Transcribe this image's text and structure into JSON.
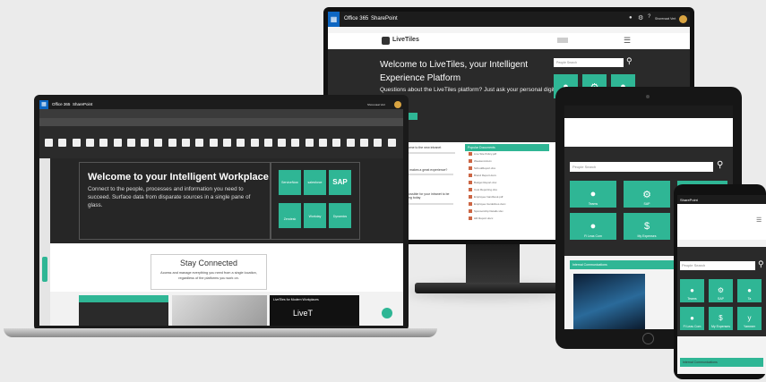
{
  "monitor": {
    "suite_title": "Office 365",
    "app_title": "SharePoint",
    "user_name": "Shorenaat Vert",
    "search_placeholder": "People Search",
    "brand": "LiveTiles",
    "hero_title": "Welcome to LiveTiles, your Intelligent Experience Platform",
    "hero_subtitle": "Questions about the LiveTiles platform? Just ask your personal digital",
    "news_title": "Welcome to the new intranet",
    "news_heading": "What makes a great experience?",
    "news_heading_2": "Is it possible for your intranet to be exciting today",
    "docs_title": "Popular Documents",
    "documents": [
      "Live Site Policy.pdf",
      "Weekend.docx",
      "SchoolReport.xlsx",
      "Brand Report.docx",
      "Budget Report.xlsx",
      "Cost Reporting.xlsx",
      "Employee handbook.pdf",
      "Employee Guidelines.docx",
      "Sponsorship Details.xlsx",
      "HR Report.docx"
    ]
  },
  "laptop": {
    "suite_title": "Office 365",
    "app_title": "SharePoint",
    "user_name": "Shorenaat Vert",
    "hero_title": "Welcome to your Intelligent Workplace",
    "hero_body": "Connect to the people, processes and information you need to succeed. Surface data from disparate sources in a single pane of glass.",
    "section_title": "Stay Connected",
    "section_body": "Access and manage everything you need from a single location, regardless of the platforms you work on.",
    "video_title": "LiveTiles for Modern Workplaces",
    "video_brand": "LiveT",
    "tile_logos": [
      "ServiceNow",
      "salesforce",
      "SAP",
      "Zendesk",
      "Workday",
      "Dynamics"
    ]
  },
  "tablet": {
    "search_placeholder": "People Search",
    "tiles": [
      "Teams",
      "SAP",
      "",
      "Fi Leas Com",
      "My Expenses",
      ""
    ],
    "banner": "Internal Communications"
  },
  "phone": {
    "app_title": "SharePoint",
    "search_placeholder": "People Search",
    "tiles": [
      "Teams",
      "SAP",
      "Ta",
      "Fi Leas Com",
      "My Expenses",
      "Yammer"
    ],
    "banner": "Internal Communications"
  },
  "colors": {
    "accent": "#2fb695",
    "dark": "#2a2a2a",
    "suite": "#1c1c1c",
    "office_blue": "#0d66c2",
    "page_bg": "#ebebeb"
  }
}
